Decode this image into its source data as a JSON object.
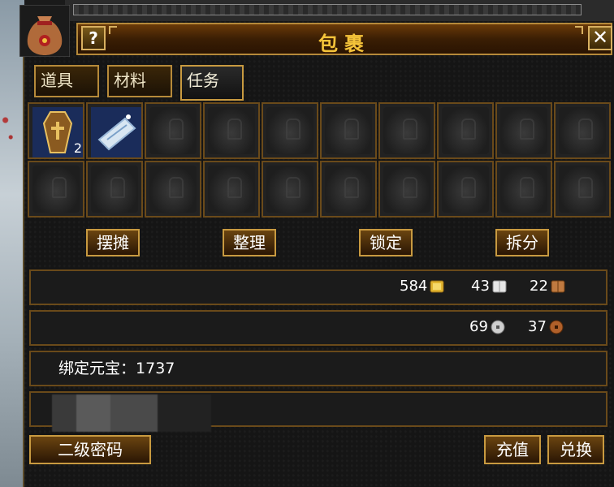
{
  "window": {
    "title": "包裹",
    "help_label": "?",
    "close_label": "✕"
  },
  "tabs": [
    {
      "label": "道具"
    },
    {
      "label": "材料"
    },
    {
      "label": "任务",
      "active": true
    }
  ],
  "slots": [
    {
      "item": "coffin-item-icon",
      "qty": "2"
    },
    {
      "item": "scroll-item-icon",
      "qty": ""
    }
  ],
  "actions": [
    "摆摊",
    "整理",
    "锁定",
    "拆分"
  ],
  "currency_row1": [
    {
      "value": "584",
      "icon": "gold-ingot-icon",
      "color": "#e2b530"
    },
    {
      "value": "43",
      "icon": "silver-book-icon",
      "color": "#e6e6e6"
    },
    {
      "value": "22",
      "icon": "bronze-book-icon",
      "color": "#c07a40"
    }
  ],
  "currency_row2": [
    {
      "value": "69",
      "icon": "silver-coin-icon",
      "color": "#cfcfcf"
    },
    {
      "value": "37",
      "icon": "copper-coin-icon",
      "color": "#b0602a"
    }
  ],
  "bound_yuanbao": {
    "label": "绑定元宝：",
    "value": "1737"
  },
  "bottom": {
    "password": "二级密码",
    "recharge": "充值",
    "exchange": "兑换"
  }
}
